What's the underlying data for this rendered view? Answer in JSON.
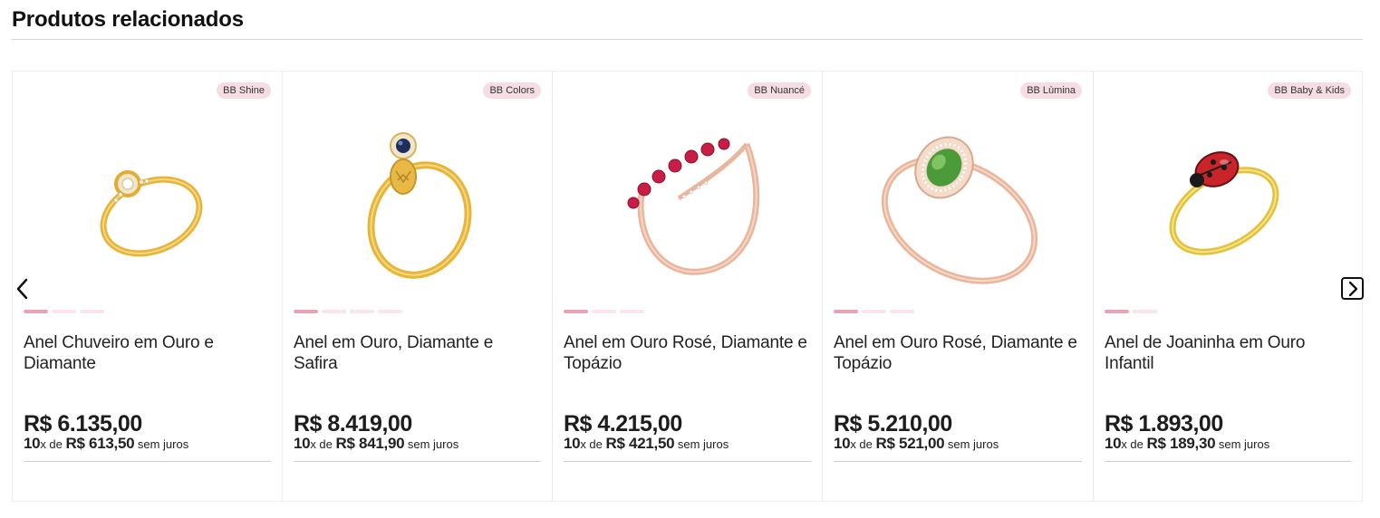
{
  "section": {
    "title": "Produtos relacionados"
  },
  "carousel": {
    "prev_icon": "chevron-left-icon",
    "next_icon": "chevron-right-icon",
    "products": [
      {
        "badge": "BB Shine",
        "name": "Anel Chuveiro em Ouro e Diamante",
        "price": "R$ 6.135,00",
        "installment_count": "10",
        "installment_x_de": "x de ",
        "installment_value": "R$ 613,50",
        "installment_suffix": " sem juros",
        "image_slides": 3,
        "active_slide": 1,
        "image": "gold-ring-diamond-halo",
        "metal_color": "#e7b43a"
      },
      {
        "badge": "BB Colors",
        "name": "Anel em Ouro, Diamante e Safira",
        "price": "R$ 8.419,00",
        "installment_count": "10",
        "installment_x_de": "x de ",
        "installment_value": "R$ 841,90",
        "installment_suffix": " sem juros",
        "image_slides": 4,
        "active_slide": 1,
        "image": "gold-ring-sapphire-pendant",
        "metal_color": "#e8b53b"
      },
      {
        "badge": "BB Nuancé",
        "name": "Anel em Ouro Rosé, Diamante e Topázio",
        "price": "R$ 4.215,00",
        "installment_count": "10",
        "installment_x_de": "x de ",
        "installment_value": "R$ 421,50",
        "installment_suffix": " sem juros",
        "image_slides": 3,
        "active_slide": 1,
        "image": "rose-gold-ring-red-topaz-row",
        "metal_color": "#e9b59d"
      },
      {
        "badge": "BB Lùmina",
        "name": "Anel em Ouro Rosé, Diamante e Topázio",
        "price": "R$ 5.210,00",
        "installment_count": "10",
        "installment_x_de": "x de ",
        "installment_value": "R$ 521,00",
        "installment_suffix": " sem juros",
        "image_slides": 3,
        "active_slide": 1,
        "image": "rose-gold-ring-green-oval-stone",
        "metal_color": "#e9b59d"
      },
      {
        "badge": "BB Baby & Kids",
        "name": "Anel de Joaninha em Ouro Infantil",
        "price": "R$ 1.893,00",
        "installment_count": "10",
        "installment_x_de": "x de ",
        "installment_value": "R$ 189,30",
        "installment_suffix": " sem juros",
        "image_slides": 2,
        "active_slide": 1,
        "image": "gold-ring-ladybug",
        "metal_color": "#e2c23c"
      }
    ]
  },
  "colors": {
    "badge_bg": "#f6dde4",
    "dot_active": "#e7a4b6",
    "dot_inactive": "#fbe4ea"
  }
}
